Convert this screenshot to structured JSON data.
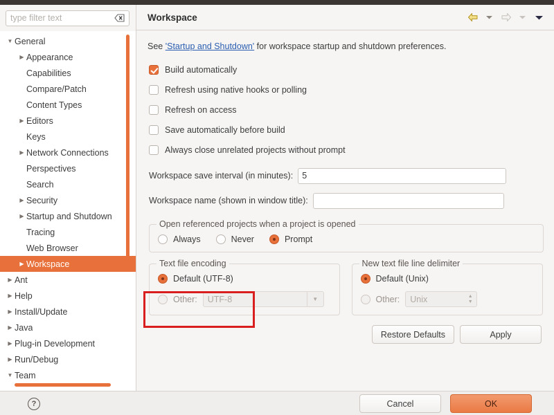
{
  "filter": {
    "placeholder": "type filter text",
    "value": "",
    "clear_icon": "clear-icon"
  },
  "tree": {
    "items": [
      {
        "label": "General",
        "indent": 0,
        "arrow": "down",
        "selected": false
      },
      {
        "label": "Appearance",
        "indent": 1,
        "arrow": "right",
        "selected": false
      },
      {
        "label": "Capabilities",
        "indent": 1,
        "arrow": "none",
        "selected": false
      },
      {
        "label": "Compare/Patch",
        "indent": 1,
        "arrow": "none",
        "selected": false
      },
      {
        "label": "Content Types",
        "indent": 1,
        "arrow": "none",
        "selected": false
      },
      {
        "label": "Editors",
        "indent": 1,
        "arrow": "right",
        "selected": false
      },
      {
        "label": "Keys",
        "indent": 1,
        "arrow": "none",
        "selected": false
      },
      {
        "label": "Network Connections",
        "indent": 1,
        "arrow": "right",
        "selected": false
      },
      {
        "label": "Perspectives",
        "indent": 1,
        "arrow": "none",
        "selected": false
      },
      {
        "label": "Search",
        "indent": 1,
        "arrow": "none",
        "selected": false
      },
      {
        "label": "Security",
        "indent": 1,
        "arrow": "right",
        "selected": false
      },
      {
        "label": "Startup and Shutdown",
        "indent": 1,
        "arrow": "right",
        "selected": false
      },
      {
        "label": "Tracing",
        "indent": 1,
        "arrow": "none",
        "selected": false
      },
      {
        "label": "Web Browser",
        "indent": 1,
        "arrow": "none",
        "selected": false
      },
      {
        "label": "Workspace",
        "indent": 1,
        "arrow": "right",
        "selected": true
      },
      {
        "label": "Ant",
        "indent": 0,
        "arrow": "right",
        "selected": false
      },
      {
        "label": "Help",
        "indent": 0,
        "arrow": "right",
        "selected": false
      },
      {
        "label": "Install/Update",
        "indent": 0,
        "arrow": "right",
        "selected": false
      },
      {
        "label": "Java",
        "indent": 0,
        "arrow": "right",
        "selected": false
      },
      {
        "label": "Plug-in Development",
        "indent": 0,
        "arrow": "right",
        "selected": false
      },
      {
        "label": "Run/Debug",
        "indent": 0,
        "arrow": "right",
        "selected": false
      },
      {
        "label": "Team",
        "indent": 0,
        "arrow": "down",
        "selected": false
      }
    ],
    "selection_color": "#e8703a",
    "scrollbar_color": "#e8703a"
  },
  "header": {
    "title": "Workspace",
    "back_icon": "back-arrow-icon",
    "back_menu_icon": "chevron-down-icon",
    "forward_icon": "forward-arrow-icon",
    "forward_menu_icon": "chevron-down-icon",
    "menu_icon": "chevron-down-icon"
  },
  "intro": {
    "prefix": "See ",
    "link": "'Startup and Shutdown'",
    "suffix": " for workspace startup and shutdown preferences."
  },
  "checkboxes": [
    {
      "label": "Build automatically",
      "checked": true
    },
    {
      "label": "Refresh using native hooks or polling",
      "checked": false
    },
    {
      "label": "Refresh on access",
      "checked": false
    },
    {
      "label": "Save automatically before build",
      "checked": false
    },
    {
      "label": "Always close unrelated projects without prompt",
      "checked": false
    }
  ],
  "fields": {
    "save_interval_label": "Workspace save interval (in minutes):",
    "save_interval_value": "5",
    "workspace_name_label": "Workspace name (shown in window title):",
    "workspace_name_value": "",
    "workspace_name_placeholder": ""
  },
  "open_referenced": {
    "title": "Open referenced projects when a project is opened",
    "options": [
      {
        "label": "Always",
        "selected": false
      },
      {
        "label": "Never",
        "selected": false
      },
      {
        "label": "Prompt",
        "selected": true
      }
    ]
  },
  "text_encoding": {
    "title": "Text file encoding",
    "default_label": "Default (UTF-8)",
    "default_selected": true,
    "other_label": "Other:",
    "other_selected": false,
    "other_value": "UTF-8",
    "other_enabled": false,
    "dropdown_icon": "chevron-down-icon",
    "highlight_color": "#d81e1e"
  },
  "line_delimiter": {
    "title": "New text file line delimiter",
    "default_label": "Default (Unix)",
    "default_selected": true,
    "other_label": "Other:",
    "other_selected": false,
    "other_value": "Unix",
    "other_enabled": false,
    "spinner_icon": "spinner-arrows-icon"
  },
  "page_buttons": {
    "restore_defaults": "Restore Defaults",
    "apply": "Apply"
  },
  "footer": {
    "help_icon": "help-icon",
    "help_glyph": "?",
    "cancel": "Cancel",
    "ok": "OK",
    "ok_color": "#ea7a45"
  }
}
